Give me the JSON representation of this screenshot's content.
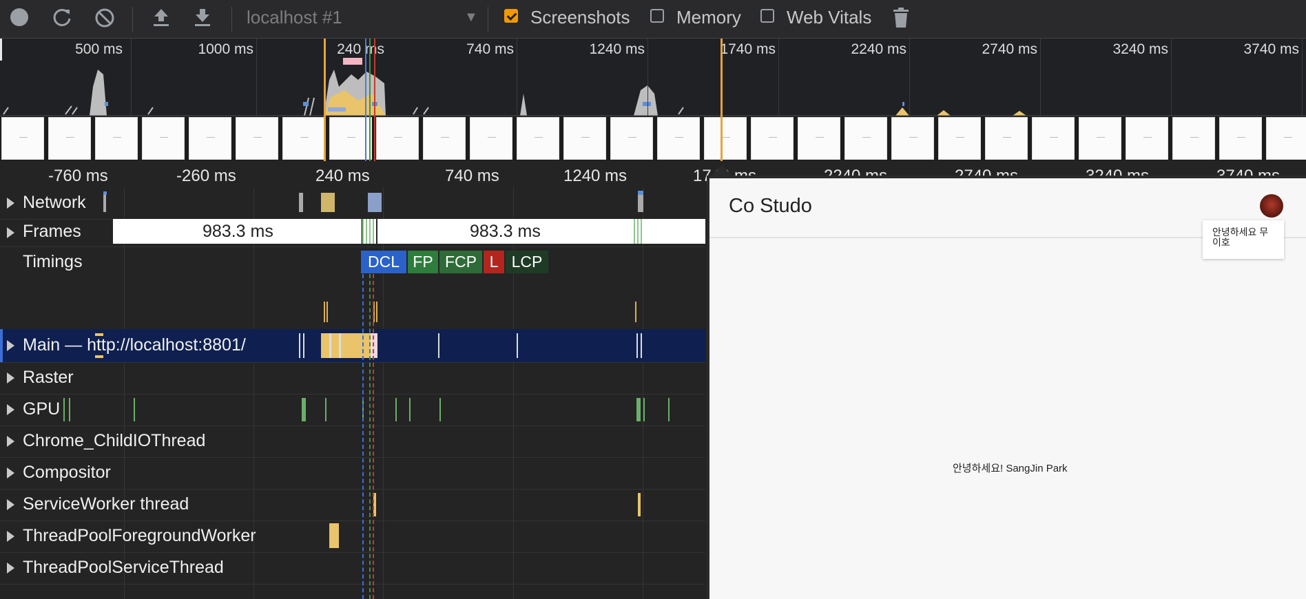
{
  "toolbar": {
    "url_select": "localhost #1",
    "checkboxes": [
      {
        "label": "Screenshots",
        "checked": true
      },
      {
        "label": "Memory",
        "checked": false
      },
      {
        "label": "Web Vitals",
        "checked": false
      }
    ]
  },
  "overview": {
    "ticks": [
      "500 ms",
      "1000 ms",
      "240 ms",
      "740 ms",
      "1240 ms",
      "1740 ms",
      "2240 ms",
      "2740 ms",
      "3240 ms",
      "3740 ms"
    ]
  },
  "ruler": {
    "ticks": [
      "-760 ms",
      "-260 ms",
      "240 ms",
      "740 ms",
      "1240 ms",
      "1740 ms",
      "2240 ms",
      "2740 ms",
      "3240 ms",
      "3740 ms"
    ]
  },
  "tracks": {
    "network": "Network",
    "frames": "Frames",
    "timings": "Timings",
    "main": "Main — http://localhost:8801/",
    "raster": "Raster",
    "gpu": "GPU",
    "childio": "Chrome_ChildIOThread",
    "compositor": "Compositor",
    "serviceworker": "ServiceWorker thread",
    "tpforeground": "ThreadPoolForegroundWorker",
    "tpservice": "ThreadPoolServiceThread"
  },
  "frames": {
    "frame1": "983.3 ms",
    "frame2": "983.3 ms"
  },
  "timings": {
    "dcl": "DCL",
    "fp": "FP",
    "fcp": "FCP",
    "l": "L",
    "lcp": "LCP"
  },
  "colors": {
    "dcl": "#2a62c9",
    "fp": "#2e7d3c",
    "fcp": "#2e6b38",
    "l": "#b3261e",
    "lcp": "#1f3b26",
    "main_selected": "#0f2050",
    "accent": "#f29900"
  },
  "preview": {
    "app_title": "Co Studo",
    "popup_text": "안녕하세요 무이호",
    "center_text": "안녕하세요! SangJin Park"
  }
}
